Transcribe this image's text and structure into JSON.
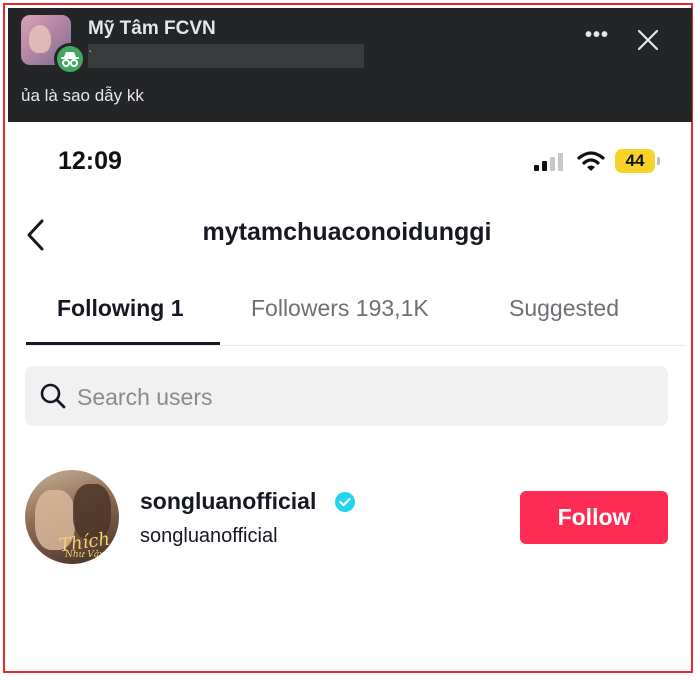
{
  "facebook_post": {
    "group_name": "Mỹ Tâm FCVN",
    "sub_prefix": "·",
    "caption": "ủa là sao dẫy kk",
    "more_label": "•••",
    "avatar_icon": "incognito-icon",
    "close_icon": "close-icon",
    "colors": {
      "background": "#242526",
      "badge": "#42a661"
    }
  },
  "phone_status": {
    "time": "12:09",
    "battery": "44",
    "icons": [
      "cellular-signal-icon",
      "wifi-icon",
      "battery-icon"
    ]
  },
  "profile": {
    "username": "mytamchuaconoidunggi",
    "back_icon": "chevron-left-icon"
  },
  "tabs": [
    {
      "label": "Following 1",
      "active": true
    },
    {
      "label": "Followers 193,1K",
      "active": false
    },
    {
      "label": "Suggested",
      "active": false
    }
  ],
  "search": {
    "placeholder": "Search users",
    "value": ""
  },
  "users": [
    {
      "display_name": "songluanofficial",
      "handle": "songluanofficial",
      "verified": true,
      "avatar_text": "Thích",
      "avatar_subtext": "Như Vậy",
      "follow_label": "Follow"
    }
  ],
  "colors": {
    "follow_button": "#fe2c55",
    "verified_badge": "#20d5ec",
    "frame_border": "#e8262b",
    "battery": "#f7d32a"
  }
}
